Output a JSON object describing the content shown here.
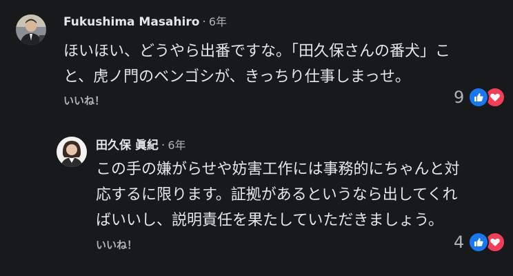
{
  "comments": [
    {
      "author": "Fukushima Masahiro",
      "time": "6年",
      "lines": [
        "ほいほい、どうやら出番ですな。「田久保さんの番犬」こ",
        "と、虎ノ門のベンゴシが、きっちり仕事しまっせ。"
      ],
      "like_label": "いいね！",
      "reaction_count": "9",
      "reaction_icons": [
        "like-icon",
        "love-icon"
      ]
    },
    {
      "author": "田久保 眞紀",
      "time": "6年",
      "lines": [
        "この手の嫌がらせや妨害工作には事務的にちゃんと対",
        "応するに限ります。証拠があるというなら出してくれ",
        "ばいいし、説明責任を果たしていただきましょう。"
      ],
      "like_label": "いいね！",
      "reaction_count": "4",
      "reaction_icons": [
        "like-icon",
        "love-icon"
      ]
    }
  ],
  "separator": "·",
  "colors": {
    "background": "#18191a",
    "text": "#e4e6eb",
    "muted": "#b0b3b8",
    "like": "#1877f2",
    "love": "#f33e58"
  }
}
